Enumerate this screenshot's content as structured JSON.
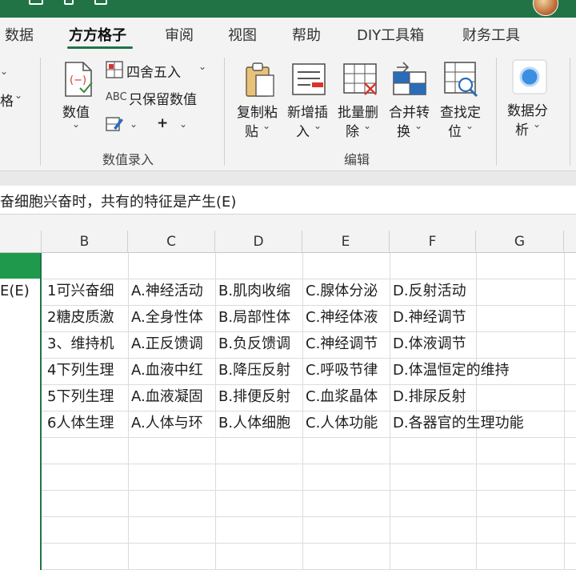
{
  "colors": {
    "accent": "#217346",
    "selection": "#1f9a4c"
  },
  "tabs": [
    {
      "label": "数据"
    },
    {
      "label": "方方格子"
    },
    {
      "label": "审阅"
    },
    {
      "label": "视图"
    },
    {
      "label": "帮助"
    },
    {
      "label": "DIY工具箱"
    },
    {
      "label": "财务工具"
    }
  ],
  "ribbon": {
    "left_partial": "格",
    "numeric": {
      "label": "数值"
    },
    "round": {
      "label": "四舍五入"
    },
    "keep": {
      "abc": "ABC",
      "label": "只保留数值"
    },
    "group_label": "数值录入",
    "edit": {
      "copy": [
        "复制粘",
        "贴"
      ],
      "insert": [
        "新增插",
        "入"
      ],
      "delete": [
        "批量删",
        "除"
      ],
      "merge": [
        "合并转",
        "换"
      ],
      "find": [
        "查找定",
        "位"
      ],
      "group_label": "编辑"
    },
    "analysis": [
      "数据分",
      "析"
    ]
  },
  "formula": {
    "text": "奋细胞兴奋时，共有的特征是产生(E)"
  },
  "columns": [
    "B",
    "C",
    "D",
    "E",
    "F",
    "G"
  ],
  "rows": [
    {
      "a": "E(E)",
      "b": "1可兴奋细",
      "c": "A.神经活动",
      "d": "B.肌肉收缩",
      "e": "C.腺体分泌",
      "f": "D.反射活动"
    },
    {
      "a": "",
      "b": "2糖皮质激",
      "c": "A.全身性体",
      "d": "B.局部性体",
      "e": "C.神经体液",
      "f": "D.神经调节"
    },
    {
      "a": "",
      "b": "3、维持机",
      "c": "A.正反馈调",
      "d": "B.负反馈调",
      "e": "C.神经调节",
      "f": "D.体液调节"
    },
    {
      "a": "",
      "b": "4下列生理",
      "c": "A.血液中红",
      "d": "B.降压反射",
      "e": "C.呼吸节律",
      "f": "D.体温恒定的维持"
    },
    {
      "a": "",
      "b": "5下列生理",
      "c": "A.血液凝固",
      "d": "B.排便反射",
      "e": "C.血浆晶体",
      "f": "D.排尿反射"
    },
    {
      "a": "",
      "b": "6人体生理",
      "c": "A.人体与环",
      "d": "B.人体细胞",
      "e": "C.人体功能",
      "f": "D.各器官的生理功能"
    }
  ]
}
